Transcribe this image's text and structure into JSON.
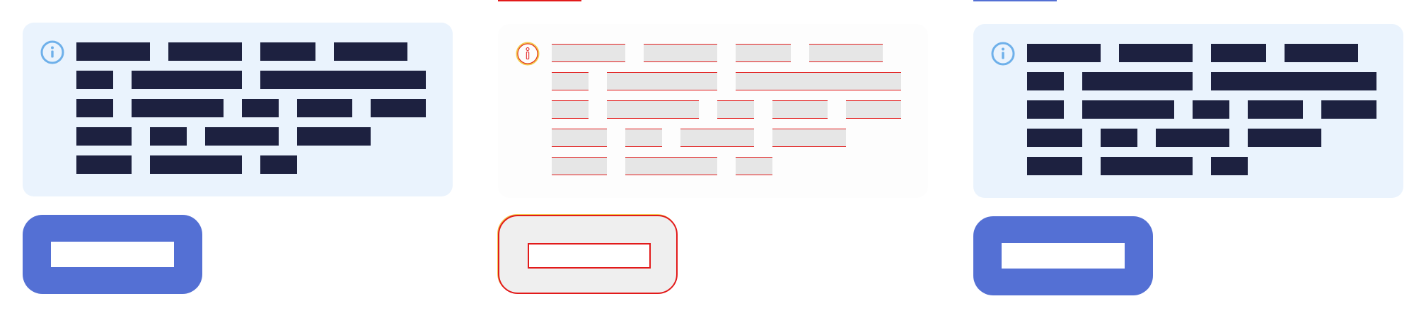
{
  "colors": {
    "alert_bg": "#eaf3fd",
    "text_block": "#1d2140",
    "button_primary": "#5470d4",
    "info_icon": "#6eb0ea",
    "diff_red": "#e21a1a"
  },
  "panels": [
    {
      "variant": "solid",
      "top_rule_color": "",
      "alert": {
        "icon": "info-icon"
      },
      "button": {
        "label": ""
      }
    },
    {
      "variant": "diff",
      "top_rule_color": "#e21a1a",
      "alert": {
        "icon": "info-icon"
      },
      "button": {
        "label": ""
      }
    },
    {
      "variant": "solid",
      "top_rule_color": "#5470d4",
      "alert": {
        "icon": "info-icon"
      },
      "button": {
        "label": ""
      }
    }
  ],
  "alert_message_lines": [
    [
      "",
      "",
      "",
      ""
    ],
    [
      "",
      "",
      ""
    ],
    [
      "",
      "",
      "",
      "",
      ""
    ],
    [
      "",
      "",
      "",
      ""
    ],
    [
      "",
      "",
      ""
    ]
  ]
}
